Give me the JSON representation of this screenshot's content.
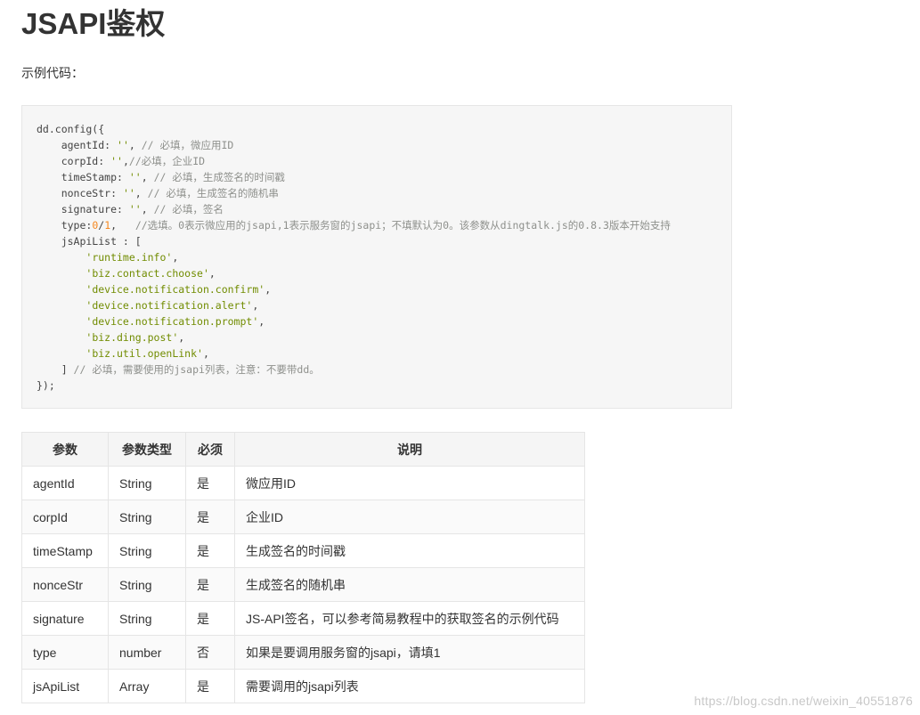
{
  "page": {
    "title": "JSAPI鉴权",
    "intro": "示例代码："
  },
  "code_lines": [
    [
      {
        "t": "dd.config({",
        "k": ""
      }
    ],
    [
      {
        "t": "    agentId: ",
        "k": ""
      },
      {
        "t": "''",
        "k": "s"
      },
      {
        "t": ", ",
        "k": ""
      },
      {
        "t": "// 必填，微应用ID",
        "k": "c"
      }
    ],
    [
      {
        "t": "    corpId: ",
        "k": ""
      },
      {
        "t": "''",
        "k": "s"
      },
      {
        "t": ",",
        "k": ""
      },
      {
        "t": "//必填，企业ID",
        "k": "c"
      }
    ],
    [
      {
        "t": "    timeStamp: ",
        "k": ""
      },
      {
        "t": "''",
        "k": "s"
      },
      {
        "t": ", ",
        "k": ""
      },
      {
        "t": "// 必填，生成签名的时间戳",
        "k": "c"
      }
    ],
    [
      {
        "t": "    nonceStr: ",
        "k": ""
      },
      {
        "t": "''",
        "k": "s"
      },
      {
        "t": ", ",
        "k": ""
      },
      {
        "t": "// 必填，生成签名的随机串",
        "k": "c"
      }
    ],
    [
      {
        "t": "    signature: ",
        "k": ""
      },
      {
        "t": "''",
        "k": "s"
      },
      {
        "t": ", ",
        "k": ""
      },
      {
        "t": "// 必填，签名",
        "k": "c"
      }
    ],
    [
      {
        "t": "    type:",
        "k": ""
      },
      {
        "t": "0",
        "k": "n"
      },
      {
        "t": "/",
        "k": ""
      },
      {
        "t": "1",
        "k": "n"
      },
      {
        "t": ",   ",
        "k": ""
      },
      {
        "t": "//选填。0表示微应用的jsapi,1表示服务窗的jsapi；不填默认为0。该参数从dingtalk.js的0.8.3版本开始支持",
        "k": "c"
      }
    ],
    [
      {
        "t": "    jsApiList : [",
        "k": ""
      }
    ],
    [
      {
        "t": "        ",
        "k": ""
      },
      {
        "t": "'runtime.info'",
        "k": "s"
      },
      {
        "t": ",",
        "k": ""
      }
    ],
    [
      {
        "t": "        ",
        "k": ""
      },
      {
        "t": "'biz.contact.choose'",
        "k": "s"
      },
      {
        "t": ",",
        "k": ""
      }
    ],
    [
      {
        "t": "        ",
        "k": ""
      },
      {
        "t": "'device.notification.confirm'",
        "k": "s"
      },
      {
        "t": ",",
        "k": ""
      }
    ],
    [
      {
        "t": "        ",
        "k": ""
      },
      {
        "t": "'device.notification.alert'",
        "k": "s"
      },
      {
        "t": ",",
        "k": ""
      }
    ],
    [
      {
        "t": "        ",
        "k": ""
      },
      {
        "t": "'device.notification.prompt'",
        "k": "s"
      },
      {
        "t": ",",
        "k": ""
      }
    ],
    [
      {
        "t": "        ",
        "k": ""
      },
      {
        "t": "'biz.ding.post'",
        "k": "s"
      },
      {
        "t": ",",
        "k": ""
      }
    ],
    [
      {
        "t": "        ",
        "k": ""
      },
      {
        "t": "'biz.util.openLink'",
        "k": "s"
      },
      {
        "t": ",",
        "k": ""
      }
    ],
    [
      {
        "t": "    ] ",
        "k": ""
      },
      {
        "t": "// 必填，需要使用的jsapi列表，注意：不要带dd。",
        "k": "c"
      }
    ],
    [
      {
        "t": "});",
        "k": ""
      }
    ]
  ],
  "table": {
    "headers": [
      "参数",
      "参数类型",
      "必须",
      "说明"
    ],
    "rows": [
      [
        "agentId",
        "String",
        "是",
        "微应用ID"
      ],
      [
        "corpId",
        "String",
        "是",
        "企业ID"
      ],
      [
        "timeStamp",
        "String",
        "是",
        "生成签名的时间戳"
      ],
      [
        "nonceStr",
        "String",
        "是",
        "生成签名的随机串"
      ],
      [
        "signature",
        "String",
        "是",
        "JS-API签名，可以参考简易教程中的获取签名的示例代码"
      ],
      [
        "type",
        "number",
        "否",
        "如果是要调用服务窗的jsapi，请填1"
      ],
      [
        "jsApiList",
        "Array",
        "是",
        "需要调用的jsapi列表"
      ]
    ]
  },
  "watermark": "https://blog.csdn.net/weixin_40551876",
  "colors": {
    "string": "#718c00",
    "comment": "#8e908c",
    "number": "#f5871f",
    "code_background": "#f6f6f6"
  }
}
